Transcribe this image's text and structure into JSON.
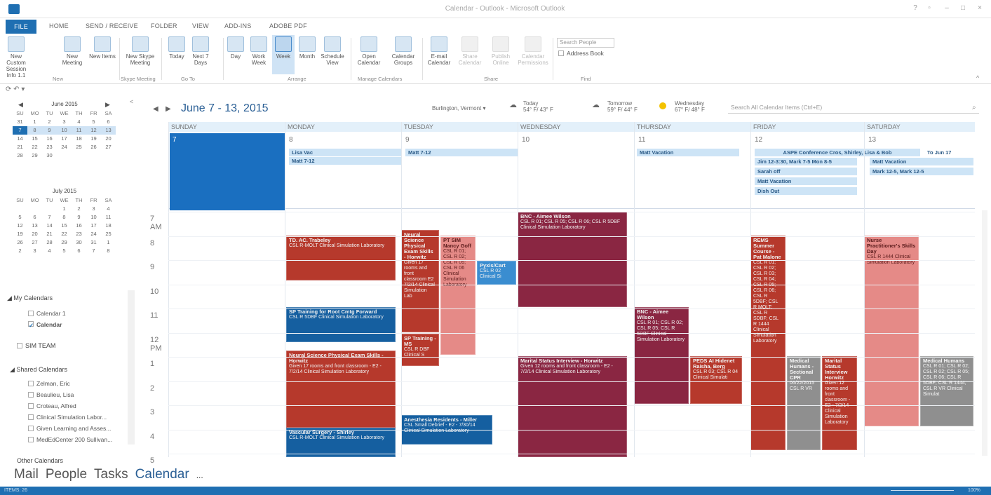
{
  "window": {
    "title": "Calendar - Outlook - Microsoft Outlook"
  },
  "tabs": [
    "FILE",
    "HOME",
    "SEND / RECEIVE",
    "FOLDER",
    "VIEW",
    "ADD-INS",
    "ADOBE PDF"
  ],
  "ribbon": {
    "buttons": [
      {
        "label": "New Custom Session Info 1.1",
        "group": "new"
      },
      {
        "label": "New Meeting",
        "group": "new"
      },
      {
        "label": "New Items",
        "group": "new"
      },
      {
        "label": "New Skype Meeting",
        "group": "skype"
      },
      {
        "label": "Today",
        "group": "goto"
      },
      {
        "label": "Next 7 Days",
        "group": "goto"
      },
      {
        "label": "Day",
        "group": "arrange"
      },
      {
        "label": "Work Week",
        "group": "arrange"
      },
      {
        "label": "Week",
        "group": "arrange"
      },
      {
        "label": "Month",
        "group": "arrange"
      },
      {
        "label": "Schedule View",
        "group": "arrange"
      },
      {
        "label": "Open Calendar",
        "group": "manage"
      },
      {
        "label": "Calendar Groups",
        "group": "manage"
      },
      {
        "label": "E-mail Calendar",
        "group": "share"
      },
      {
        "label": "Share Calendar",
        "group": "share"
      },
      {
        "label": "Publish Online",
        "group": "share"
      },
      {
        "label": "Calendar Permissions",
        "group": "share"
      }
    ],
    "groups": [
      "New",
      "Skype Meeting",
      "Go To",
      "Arrange",
      "Manage Calendars",
      "Share",
      "Find"
    ],
    "search_people": "Search People",
    "address_book": "Address Book"
  },
  "minical": {
    "june": {
      "title": "June 2015",
      "days_hdr": [
        "SU",
        "MO",
        "TU",
        "WE",
        "TH",
        "FR",
        "SA"
      ],
      "weeks": [
        [
          "31",
          "1",
          "2",
          "3",
          "4",
          "5",
          "6"
        ],
        [
          "7",
          "8",
          "9",
          "10",
          "11",
          "12",
          "13"
        ],
        [
          "14",
          "15",
          "16",
          "17",
          "18",
          "19",
          "20"
        ],
        [
          "21",
          "22",
          "23",
          "24",
          "25",
          "26",
          "27"
        ],
        [
          "28",
          "29",
          "30",
          "",
          "",
          "",
          ""
        ]
      ]
    },
    "july": {
      "title": "July 2015",
      "days_hdr": [
        "SU",
        "MO",
        "TU",
        "WE",
        "TH",
        "FR",
        "SA"
      ],
      "weeks": [
        [
          "",
          "",
          "",
          "1",
          "2",
          "3",
          "4"
        ],
        [
          "5",
          "6",
          "7",
          "8",
          "9",
          "10",
          "11"
        ],
        [
          "12",
          "13",
          "14",
          "15",
          "16",
          "17",
          "18"
        ],
        [
          "19",
          "20",
          "21",
          "22",
          "23",
          "24",
          "25"
        ],
        [
          "26",
          "27",
          "28",
          "29",
          "30",
          "31",
          "1"
        ],
        [
          "2",
          "3",
          "4",
          "5",
          "6",
          "7",
          "8"
        ]
      ]
    }
  },
  "folders": {
    "my_calendars": "My Calendars",
    "my_items": [
      {
        "label": "Calendar 1"
      },
      {
        "label": "Calendar"
      }
    ],
    "sim_team": "SIM TEAM",
    "shared": "Shared Calendars",
    "shared_items": [
      "Zelman, Eric",
      "Beaulieu, Lisa",
      "Croteau, Alfred",
      "Clinical Simulation Labor...",
      "Given Learning and Asses...",
      "MedEdCenter 200 Sullivan..."
    ],
    "other": "Other Calendars"
  },
  "nav": [
    "Mail",
    "People",
    "Tasks",
    "Calendar",
    "..."
  ],
  "header": {
    "range": "June 7 - 13, 2015",
    "location": "Burlington, Vermont",
    "weather": [
      {
        "day": "Today",
        "temp": "54° F/ 43° F"
      },
      {
        "day": "Tomorrow",
        "temp": "59° F/ 44° F"
      },
      {
        "day": "Wednesday",
        "temp": "67° F/ 48° F"
      }
    ],
    "search": "Search All Calendar Items (Ctrl+E)"
  },
  "days": [
    {
      "name": "SUNDAY",
      "num": "7"
    },
    {
      "name": "MONDAY",
      "num": "8"
    },
    {
      "name": "TUESDAY",
      "num": "9"
    },
    {
      "name": "WEDNESDAY",
      "num": "10"
    },
    {
      "name": "THURSDAY",
      "num": "11"
    },
    {
      "name": "FRIDAY",
      "num": "12"
    },
    {
      "name": "SATURDAY",
      "num": "13"
    }
  ],
  "allday": {
    "mon": [
      "Lisa Vac",
      "Matt 7-12"
    ],
    "tue": [
      "Matt 7-12"
    ],
    "thu": [
      "Matt Vacation"
    ],
    "fri": [
      "ASPE Conference Cros, Shirley, Lisa & Bob",
      "Jim 12-3:30, Mark 7-5 Mon 8-5",
      "Sarah off",
      "Matt Vacation",
      "Dish Out"
    ],
    "sat": [
      "Matt Vacation",
      "Mark 12-5, Mark 12-5",
      "To Jun 17"
    ]
  },
  "hours": [
    "7 AM",
    "8",
    "9",
    "10",
    "11",
    "12 PM",
    "1",
    "2",
    "3",
    "4",
    "5"
  ],
  "events": {
    "mon1": {
      "title": "TD. AC. Trabeley",
      "body": "CSL R-MOLT Clinical Simulation Laboratory"
    },
    "mon2": {
      "title": "SP Training for Root Cmtg Forward",
      "body": "CSL R 5DBF Clinical Simulation Laboratory"
    },
    "mon3": {
      "title": "Neural Science Physical Exam Skills - Horwitz",
      "body": "Given 17 rooms and front classroom - E2 - 7/2/14 Clinical Simulation Laboratory"
    },
    "mon4": {
      "title": "Vascular Surgery - Shirley",
      "body": "CSL R-MOLT Clinical Simulation Laboratory"
    },
    "tue1": {
      "title": "Neural Science Physical Exam Skills - Horwitz",
      "body": "Given 17 rooms and front classroom E2 7/2/14 Clinical Simulation Lab"
    },
    "tue2": {
      "title": "PT SIM Nancy Goff",
      "body": "CSL R 01; CSL R 02; CSL R 05; CSL R 06 Clinical Simulation Laboratory"
    },
    "tue3": {
      "title": "Pyxis/Cart",
      "body": "CSL R 02 Clinical Si"
    },
    "tue4": {
      "title": "SP Training - MS",
      "body": "CSL R DBF Clinical S"
    },
    "tue5": {
      "title": "Anesthesia Residents - Miller",
      "body": "CSL Small Debrief - E2 - 7/30/14 Clinical Simulation Laboratory"
    },
    "wed1": {
      "title": "BNC - Aimee Wilson",
      "body": "CSL R 01; CSL R 05; CSL R 06; CSL R 5DBF Clinical Simulation Laboratory"
    },
    "wed2": {
      "title": "Marital Status Interview - Horwitz",
      "body": "Given 12 rooms and front classroom - E2 - 7/2/14 Clinical Simulation Laboratory"
    },
    "thu1": {
      "title": "BNC - Aimee Wilson",
      "body": "CSL R 01; CSL R 02; CSL R 05; CSL R 5DBF Clinical Simulation Laboratory"
    },
    "thu2": {
      "title": "PEDS AI Hidenet Raisha, Berg",
      "body": "CSL R 03; CSL R 04 Clinical Simulati"
    },
    "fri1": {
      "title": "REMS Summer Course - Pat Malone",
      "body": "CSL R 01; CSL R 02; CSL R 03; CSL R 04; CSL R 05; CSL R 06; CSL R 5DBF; CSL R MOLT; CSL R SDBF; CSL R 1444 Clinical Simulation Laboratory"
    },
    "fri2": {
      "title": "Medical Humans - Sectional CPR",
      "body": "06/22/2015 CSL R VR"
    },
    "fri3": {
      "title": "Marital Status Interview Horwitz",
      "body": "Given 12 rooms and front classroom - E2 - 7/2/14 Clinical Simulation Laboratory"
    },
    "sat1": {
      "title": "Nurse Practitioner's Skills Day",
      "body": "CSL R 1444 Clinical Simulation Laboratory"
    },
    "sat2": {
      "title": "Medical Humans",
      "body": "CSL R 01; CSL R 02; CSL R 02; CSL R 05; CSL R 06; CSL R 5DBF; CSL R 1444; CSL R VR Clinical Simulat"
    }
  },
  "status": {
    "left": "ITEMS: 26",
    "right": "100%"
  }
}
